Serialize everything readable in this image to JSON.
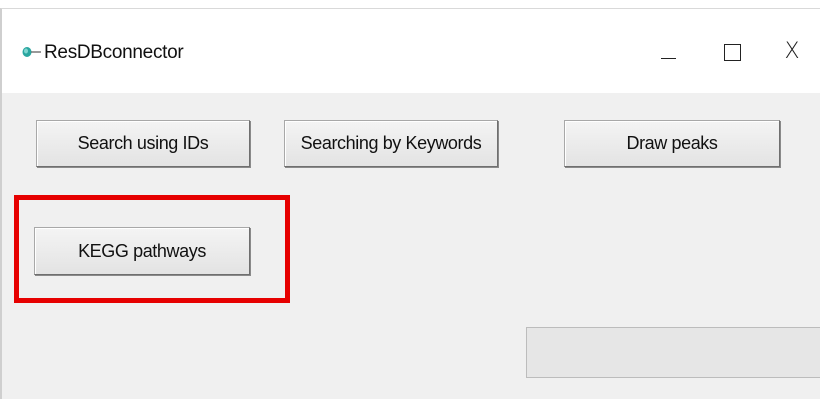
{
  "window": {
    "title": "ResDBconnector",
    "app_icon": "feather-pen-icon",
    "controls": {
      "minimize_icon": "minimize-icon",
      "maximize_icon": "maximize-icon",
      "close_icon": "close-icon",
      "close_glyph": "X"
    }
  },
  "buttons": {
    "search_ids": "Search using IDs",
    "search_keywords": "Searching by Keywords",
    "draw_peaks": "Draw peaks",
    "kegg_pathways": "KEGG pathways"
  },
  "highlight": {
    "color": "#e60000",
    "target": "kegg_pathways"
  },
  "progress": {
    "value": 0,
    "track_color": "#e6e6e6",
    "fill_color": "#06b025"
  },
  "colors": {
    "window_bg": "#f0f0f0",
    "titlebar_bg": "#ffffff",
    "icon_teal": "#2aa6a0"
  }
}
